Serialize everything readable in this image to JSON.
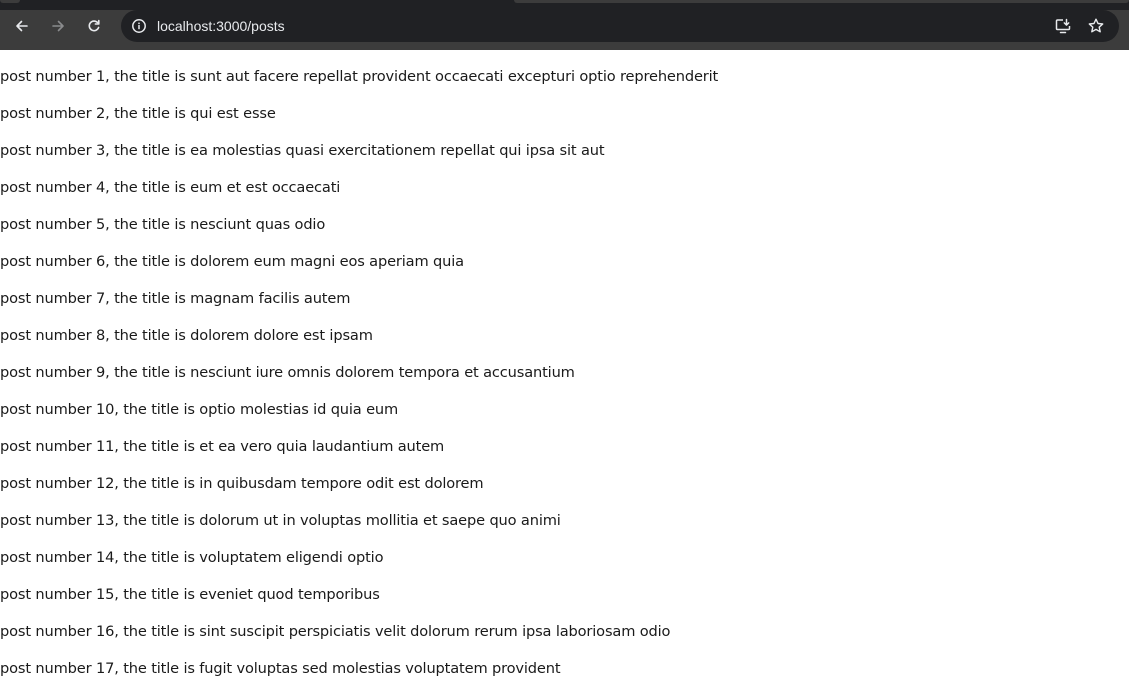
{
  "browser": {
    "url": "localhost:3000/posts",
    "icons": {
      "back": "back-arrow-icon",
      "forward": "forward-arrow-icon",
      "reload": "reload-icon",
      "site_info": "info-icon",
      "install": "install-app-icon",
      "bookmark": "star-icon"
    },
    "colors": {
      "toolbar": "#3c3c3c",
      "omnibox": "#202124",
      "url_text": "#e8eaed"
    }
  },
  "posts": [
    "post number 1, the title is sunt aut facere repellat provident occaecati excepturi optio reprehenderit",
    "post number 2, the title is qui est esse",
    "post number 3, the title is ea molestias quasi exercitationem repellat qui ipsa sit aut",
    "post number 4, the title is eum et est occaecati",
    "post number 5, the title is nesciunt quas odio",
    "post number 6, the title is dolorem eum magni eos aperiam quia",
    "post number 7, the title is magnam facilis autem",
    "post number 8, the title is dolorem dolore est ipsam",
    "post number 9, the title is nesciunt iure omnis dolorem tempora et accusantium",
    "post number 10, the title is optio molestias id quia eum",
    "post number 11, the title is et ea vero quia laudantium autem",
    "post number 12, the title is in quibusdam tempore odit est dolorem",
    "post number 13, the title is dolorum ut in voluptas mollitia et saepe quo animi",
    "post number 14, the title is voluptatem eligendi optio",
    "post number 15, the title is eveniet quod temporibus",
    "post number 16, the title is sint suscipit perspiciatis velit dolorum rerum ipsa laboriosam odio",
    "post number 17, the title is fugit voluptas sed molestias voluptatem provident"
  ]
}
